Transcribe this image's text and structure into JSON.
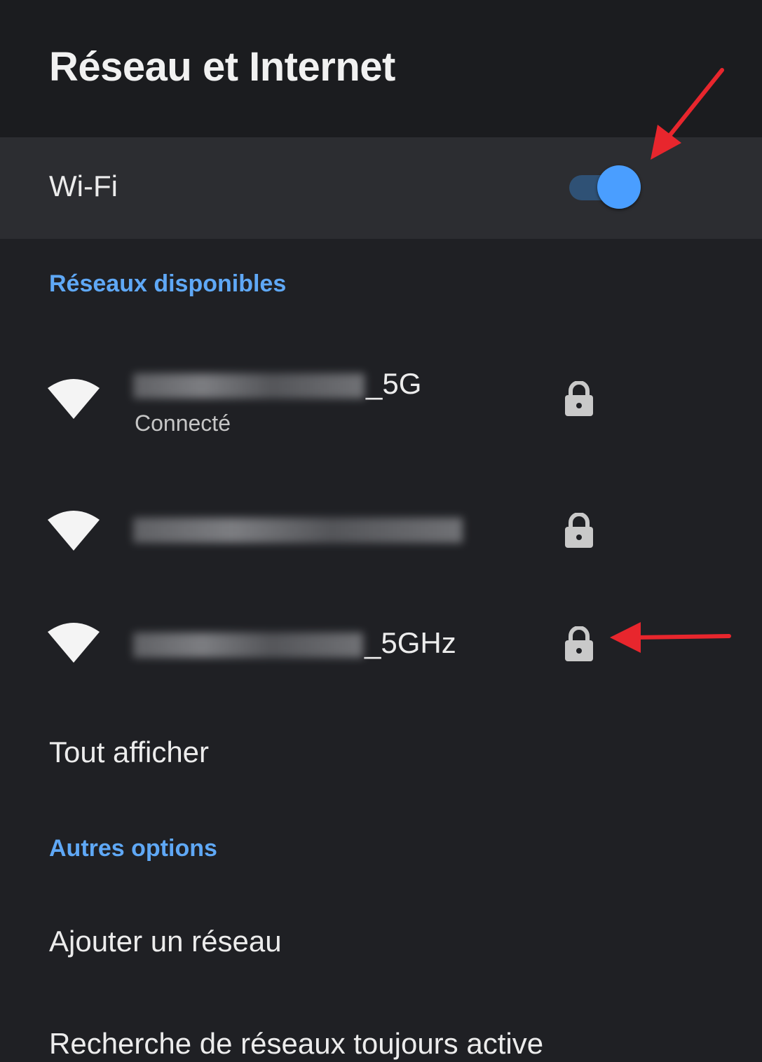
{
  "header": {
    "title": "Réseau et Internet"
  },
  "wifi": {
    "label": "Wi-Fi",
    "enabled": true,
    "toggle_color": "#4a9eff"
  },
  "available_networks": {
    "header": "Réseaux disponibles",
    "items": [
      {
        "ssid_suffix": "_5G",
        "status": "Connecté",
        "icon": "wifi-signal-icon",
        "secured": true,
        "lock_icon": "lock-icon"
      },
      {
        "ssid_suffix": "",
        "icon": "wifi-signal-icon",
        "secured": true,
        "lock_icon": "lock-icon"
      },
      {
        "ssid_suffix": "_5GHz",
        "icon": "wifi-signal-icon",
        "secured": true,
        "lock_icon": "lock-icon"
      }
    ],
    "show_all_label": "Tout afficher"
  },
  "other_options": {
    "header": "Autres options",
    "add_network_label": "Ajouter un réseau",
    "always_scan_label": "Recherche de réseaux toujours active"
  },
  "colors": {
    "accent": "#5fa8f6",
    "annotation_arrow": "#e8262d"
  }
}
